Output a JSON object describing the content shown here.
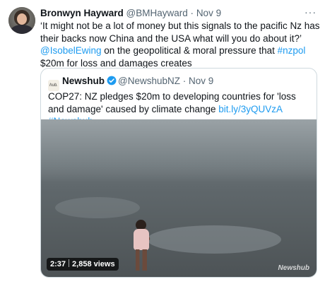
{
  "tweet": {
    "author_name": "Bronwyn Hayward",
    "author_handle": "@BMHayward",
    "separator": "·",
    "date": "Nov 9",
    "more_icon": "more-icon",
    "text_part1": "‘It might not be a lot of money but this signals to the pacific Nz has their backs now China and the USA what will you do about it?’ ",
    "mention": "@IsobelEwing",
    "text_part2": " on the geopolitical & moral pressure that ",
    "hashtag": "#nzpol",
    "text_part3": " $20m for loss and damages creates"
  },
  "quote": {
    "logo_text": "hub.",
    "name": "Newshub",
    "verified_icon": "verified-badge-icon",
    "handle": "@NewshubNZ",
    "separator": "·",
    "date": "Nov 9",
    "text": "COP27: NZ pledges $20m to developing countries for 'loss and damage' caused by climate change",
    "link": "bit.ly/3yQUVzA",
    "hashtag": "#Newshub",
    "video": {
      "duration": "2:37",
      "views": "2,858 views",
      "watermark": "Newshub"
    }
  },
  "colors": {
    "link": "#1d9bf0",
    "secondary_text": "#536471",
    "border": "#cfd9de"
  }
}
